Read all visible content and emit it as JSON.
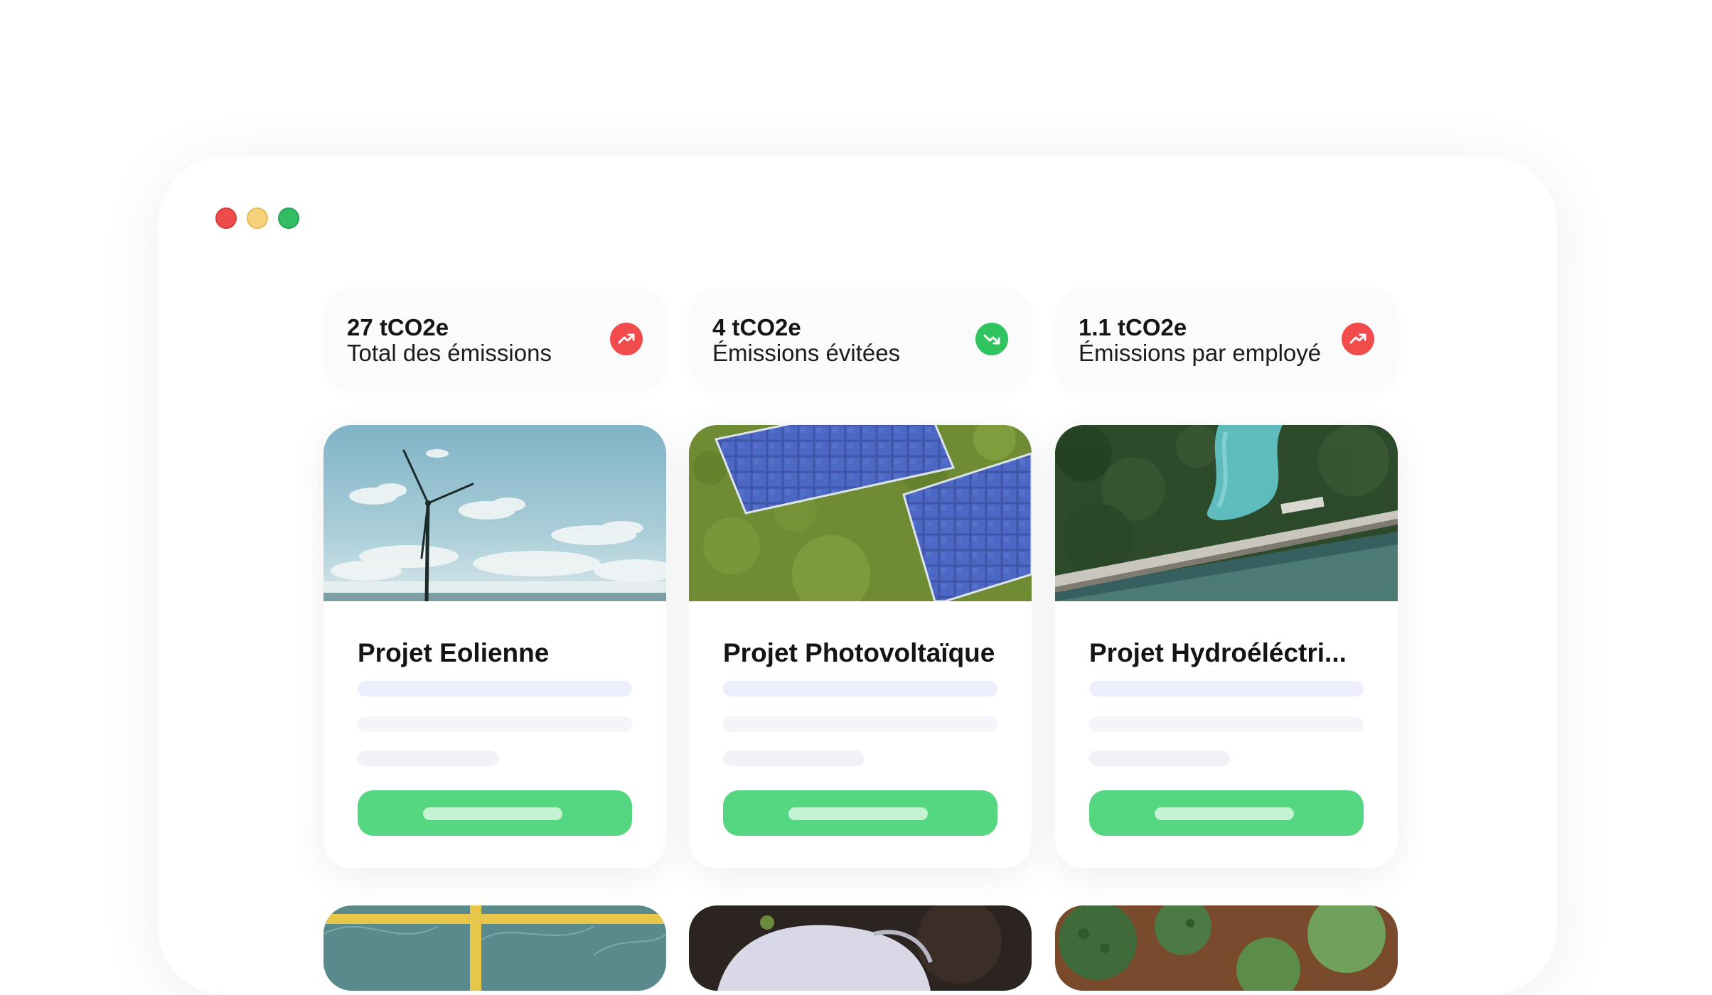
{
  "window": {
    "controls": [
      "close",
      "minimize",
      "maximize"
    ],
    "colors": {
      "close": "#ef4b4b",
      "minimize": "#f7d27c",
      "maximize": "#32bd63"
    }
  },
  "stats": [
    {
      "value": "27 tCO2e",
      "label": "Total des émissions",
      "trend": "up",
      "trend_icon": "trend-up-icon",
      "trend_color": "#f24b4b"
    },
    {
      "value": "4 tCO2e",
      "label": "Émissions évitées",
      "trend": "down",
      "trend_icon": "trend-down-icon",
      "trend_color": "#2fc45f"
    },
    {
      "value": "1.1 tCO2e",
      "label": "Émissions par employé",
      "trend": "up",
      "trend_icon": "trend-up-icon",
      "trend_color": "#f24b4b"
    }
  ],
  "projects": [
    {
      "title": "Projet Eolienne",
      "image": "wind-turbine-image"
    },
    {
      "title": "Projet Photovoltaïque",
      "image": "solar-panels-image"
    },
    {
      "title": "Projet Hydroéléctri...",
      "image": "hydroelectric-dam-image"
    }
  ],
  "bottom_cards": [
    "greenhouse-image",
    "gloved-hand-image",
    "vegetables-image"
  ],
  "accent": {
    "button": "#55d681",
    "button_pill": "#c4f2d3"
  }
}
